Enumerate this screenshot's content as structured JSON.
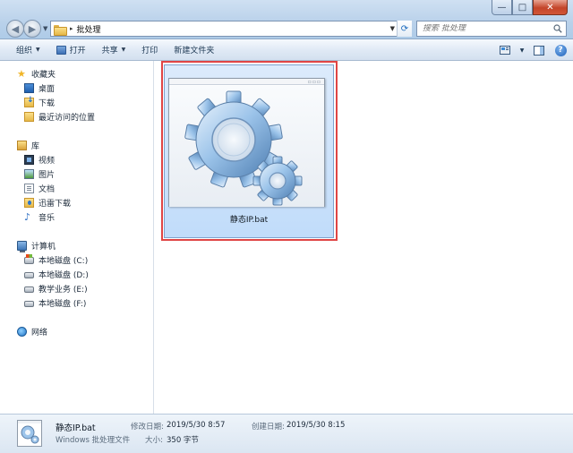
{
  "window": {
    "minimize_glyph": "—",
    "maximize_glyph": "□",
    "close_glyph": "✕"
  },
  "address_bar": {
    "path": "批处理",
    "separator": "▸"
  },
  "search": {
    "placeholder": "搜索 批处理"
  },
  "toolbar": {
    "organize": "组织",
    "open": "打开",
    "share": "共享",
    "print": "打印",
    "new_folder": "新建文件夹",
    "caret": "▼"
  },
  "sidebar": {
    "favorites": {
      "label": "收藏夹",
      "items": [
        {
          "label": "桌面",
          "icon": "desktop-icon"
        },
        {
          "label": "下载",
          "icon": "download-icon"
        },
        {
          "label": "最近访问的位置",
          "icon": "recent-places-icon"
        }
      ]
    },
    "libraries": {
      "label": "库",
      "items": [
        {
          "label": "视频",
          "icon": "video-icon"
        },
        {
          "label": "图片",
          "icon": "picture-icon"
        },
        {
          "label": "文档",
          "icon": "documents-icon"
        },
        {
          "label": "迅雷下载",
          "icon": "thunder-download-icon"
        },
        {
          "label": "音乐",
          "icon": "music-icon"
        }
      ]
    },
    "computer": {
      "label": "计算机",
      "items": [
        {
          "label": "本地磁盘 (C:)",
          "icon": "system-drive-icon"
        },
        {
          "label": "本地磁盘 (D:)",
          "icon": "drive-icon"
        },
        {
          "label": "教学业务 (E:)",
          "icon": "drive-icon"
        },
        {
          "label": "本地磁盘 (F:)",
          "icon": "drive-icon"
        }
      ]
    },
    "network": {
      "label": "网络"
    }
  },
  "content": {
    "files": [
      {
        "name": "静态IP.bat",
        "icon": "batch-gears-icon",
        "selected": true
      }
    ]
  },
  "details_pane": {
    "name": "静态IP.bat",
    "type": "Windows 批处理文件",
    "modified_label": "修改日期:",
    "modified_value": "2019/5/30 8:57",
    "size_label": "大小:",
    "size_value": "350 字节",
    "created_label": "创建日期:",
    "created_value": "2019/5/30 8:15"
  },
  "colors": {
    "selection_fill": "#c1dcfa",
    "highlight_frame": "#e04545",
    "title_bar": "#b9d1ea"
  }
}
